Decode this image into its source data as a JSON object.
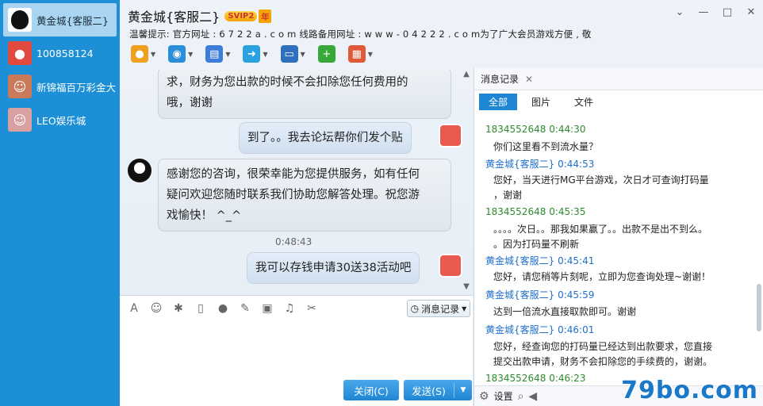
{
  "sidebar": {
    "contacts": [
      {
        "label": "黄金城{客服二}",
        "avatar_icon": "qq-penguin-icon",
        "color": "#111111"
      },
      {
        "label": "100858124",
        "avatar_icon": "bear-avatar-icon",
        "color": "#e04a3f"
      },
      {
        "label": "新锦福百万彩金大",
        "avatar_icon": "girl-avatar-icon",
        "color": "#c87a5a"
      },
      {
        "label": "LEO娱乐城",
        "avatar_icon": "photo-avatar-icon",
        "color": "#d8a0a0"
      }
    ]
  },
  "header": {
    "title": "黄金城{客服二}",
    "vip_badge": "SVIP2",
    "vip_year": "年",
    "notice": "温馨提示: 官方网址 : 6 7 2 2 a . c o m   线路备用网址 :  w w w - 0 4 2 2 2 . c o m为了广大会员游戏方便 , 敬"
  },
  "window_controls": {
    "pin": "⌄",
    "minimize": "—",
    "maximize": "□",
    "close": "✕"
  },
  "toolbar": {
    "items": [
      {
        "icon": "microphone-icon",
        "color": "#f0a020",
        "glyph": "🎤"
      },
      {
        "icon": "webcam-icon",
        "color": "#2a8fd8",
        "glyph": "◉"
      },
      {
        "icon": "screen-share-icon",
        "color": "#3b7dd8",
        "glyph": "▤"
      },
      {
        "icon": "file-transfer-icon",
        "color": "#2aa2e0",
        "glyph": "➜"
      },
      {
        "icon": "remote-desktop-icon",
        "color": "#2e6fc0",
        "glyph": "▭"
      },
      {
        "icon": "add-app-icon",
        "color": "#38a838",
        "glyph": "+"
      },
      {
        "icon": "app-grid-icon",
        "color": "#e05a3a",
        "glyph": "▦"
      }
    ]
  },
  "chat": {
    "messages": [
      {
        "from": "other",
        "text_lines": [
          "求，财务为您出款的时候不会扣除您任何费用的",
          "哦，谢谢"
        ]
      },
      {
        "from": "me",
        "text_lines": [
          "到了。。我去论坛帮你们发个贴"
        ]
      },
      {
        "from": "other",
        "text_lines": [
          "感谢您的咨询，很荣幸能为您提供服务，如有任何",
          "疑问欢迎您随时联系我们协助您解答处理。祝您游",
          "戏愉快！ ^_^"
        ]
      },
      {
        "from": "me",
        "text_lines": [
          "我可以存钱申请30送38活动吧"
        ]
      }
    ],
    "timestamp": "0:48:43"
  },
  "input": {
    "tools": [
      {
        "icon": "font-icon",
        "glyph": "A"
      },
      {
        "icon": "emoji-icon",
        "glyph": "☺"
      },
      {
        "icon": "magic-icon",
        "glyph": "✱"
      },
      {
        "icon": "shake-icon",
        "glyph": "▯"
      },
      {
        "icon": "voice-icon",
        "glyph": "♪"
      },
      {
        "icon": "edit-icon",
        "glyph": "✎"
      },
      {
        "icon": "image-icon",
        "glyph": "▣"
      },
      {
        "icon": "music-icon",
        "glyph": "♫"
      },
      {
        "icon": "screenshot-icon",
        "glyph": "✂"
      }
    ],
    "record_label": "消息记录",
    "close_label": "关闭(C)",
    "send_label": "发送(S)"
  },
  "history": {
    "title": "消息记录",
    "tabs": [
      "全部",
      "图片",
      "文件"
    ],
    "entries": [
      {
        "sender": "1834552648",
        "time": "0:44:30",
        "role": "cust",
        "lines": [
          "你们这里看不到流水量？"
        ]
      },
      {
        "sender": "黄金城{客服二}",
        "time": "0:44:53",
        "role": "staff",
        "lines": [
          "您好，当天进行MG平台游戏，次日才可查询打码量",
          "，谢谢"
        ]
      },
      {
        "sender": "1834552648",
        "time": "0:45:35",
        "role": "cust",
        "lines": [
          "。。。。次日。。那我如果赢了。。出款不是出不到么。",
          "。因为打码量不刷新"
        ]
      },
      {
        "sender": "黄金城{客服二}",
        "time": "0:45:41",
        "role": "staff",
        "lines": [
          "您好，请您稍等片刻呢，立即为您查询处理~谢谢！"
        ]
      },
      {
        "sender": "黄金城{客服二}",
        "time": "0:45:59",
        "role": "staff",
        "lines": [
          "达到一倍流水直接取款即可。谢谢"
        ]
      },
      {
        "sender": "黄金城{客服二}",
        "time": "0:46:01",
        "role": "staff",
        "lines": [
          "您好，经查询您的打码量已经达到出款要求，您直接",
          "提交出款申请，财务不会扣除您的手续费的，谢谢。"
        ]
      },
      {
        "sender": "1834552648",
        "time": "0:46:23",
        "role": "cust",
        "lines": []
      }
    ],
    "settings_label": "设置"
  },
  "watermark": "79bo.com"
}
